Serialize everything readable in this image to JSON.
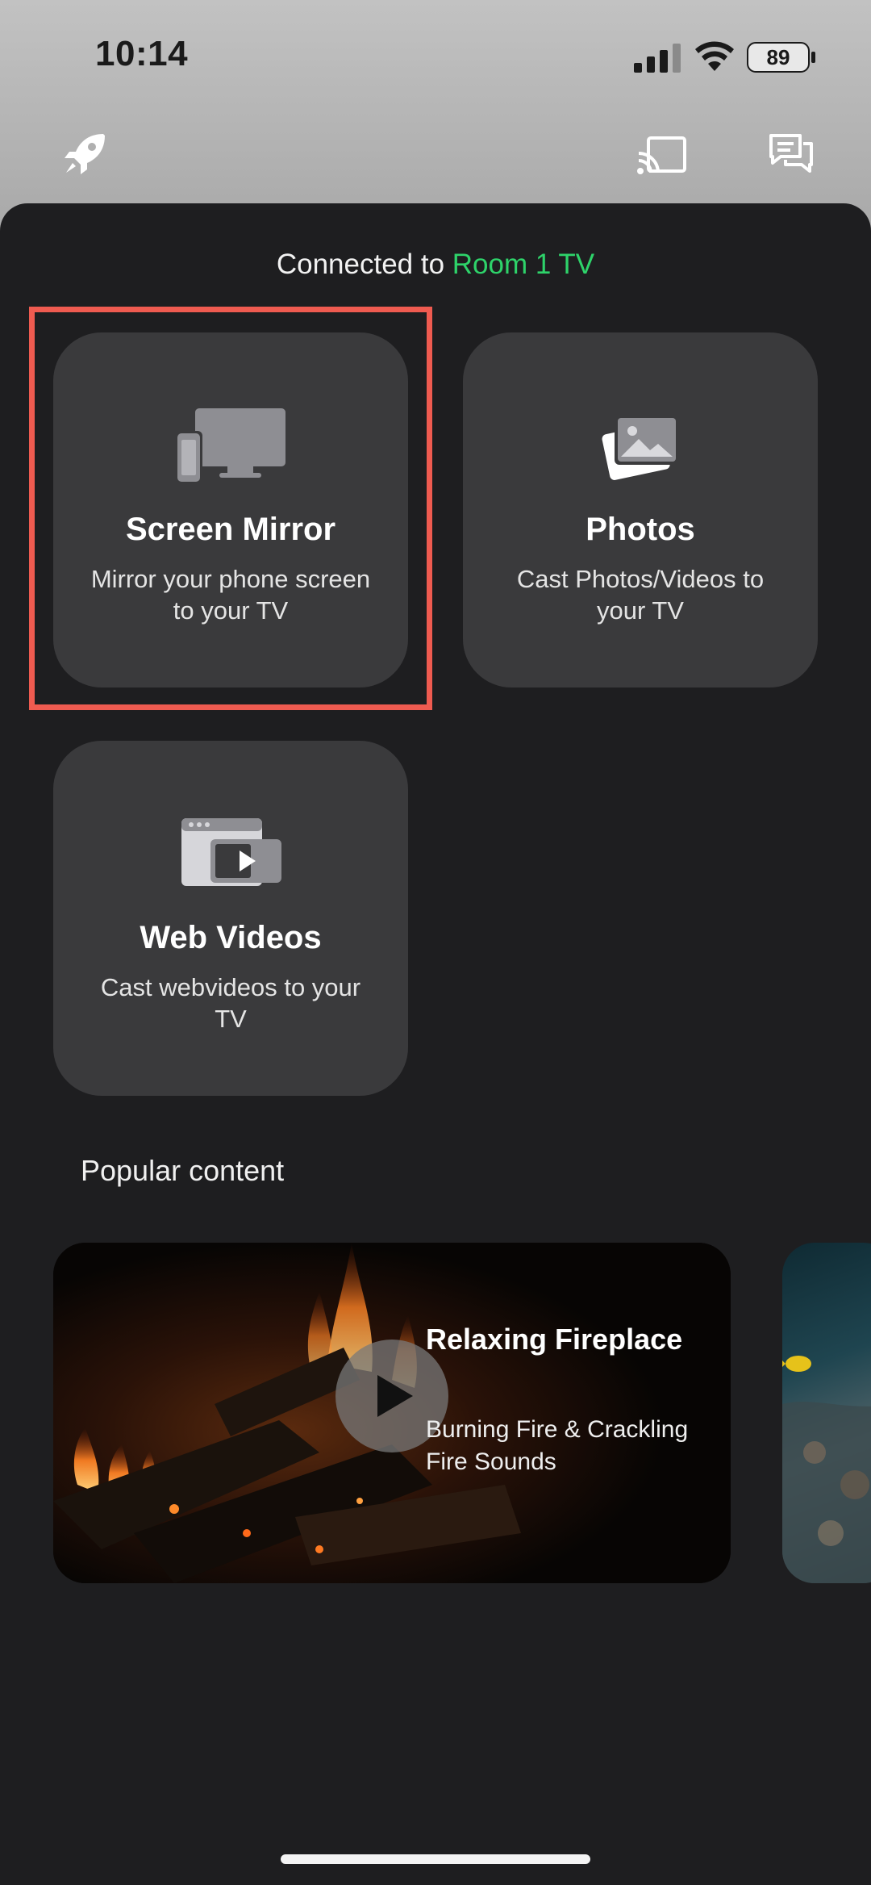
{
  "status_bar": {
    "time": "10:14",
    "battery": "89",
    "icons": [
      "signal-icon",
      "wifi-icon",
      "battery-icon"
    ]
  },
  "nav": {
    "icons": [
      "rocket-icon",
      "cast-icon",
      "chat-icon"
    ]
  },
  "connection": {
    "prefix": "Connected to ",
    "device": "Room 1 TV",
    "device_color": "#2ed36a"
  },
  "features": [
    {
      "title": "Screen Mirror",
      "subtitle": "Mirror your phone screen to your TV",
      "icon": "screen-mirror-icon"
    },
    {
      "title": "Photos",
      "subtitle": "Cast Photos/Videos to your TV",
      "icon": "photos-icon"
    },
    {
      "title": "Web Videos",
      "subtitle": "Cast webvideos to your TV",
      "icon": "web-videos-icon"
    }
  ],
  "popular": {
    "heading": "Popular content",
    "items": [
      {
        "title": "Relaxing Fireplace",
        "subtitle": "Burning Fire & Crackling Fire Sounds",
        "icon": "play-icon"
      }
    ]
  },
  "colors": {
    "highlight": "#ef5b50",
    "panel": "#1e1e20",
    "card": "#3a3a3c"
  }
}
